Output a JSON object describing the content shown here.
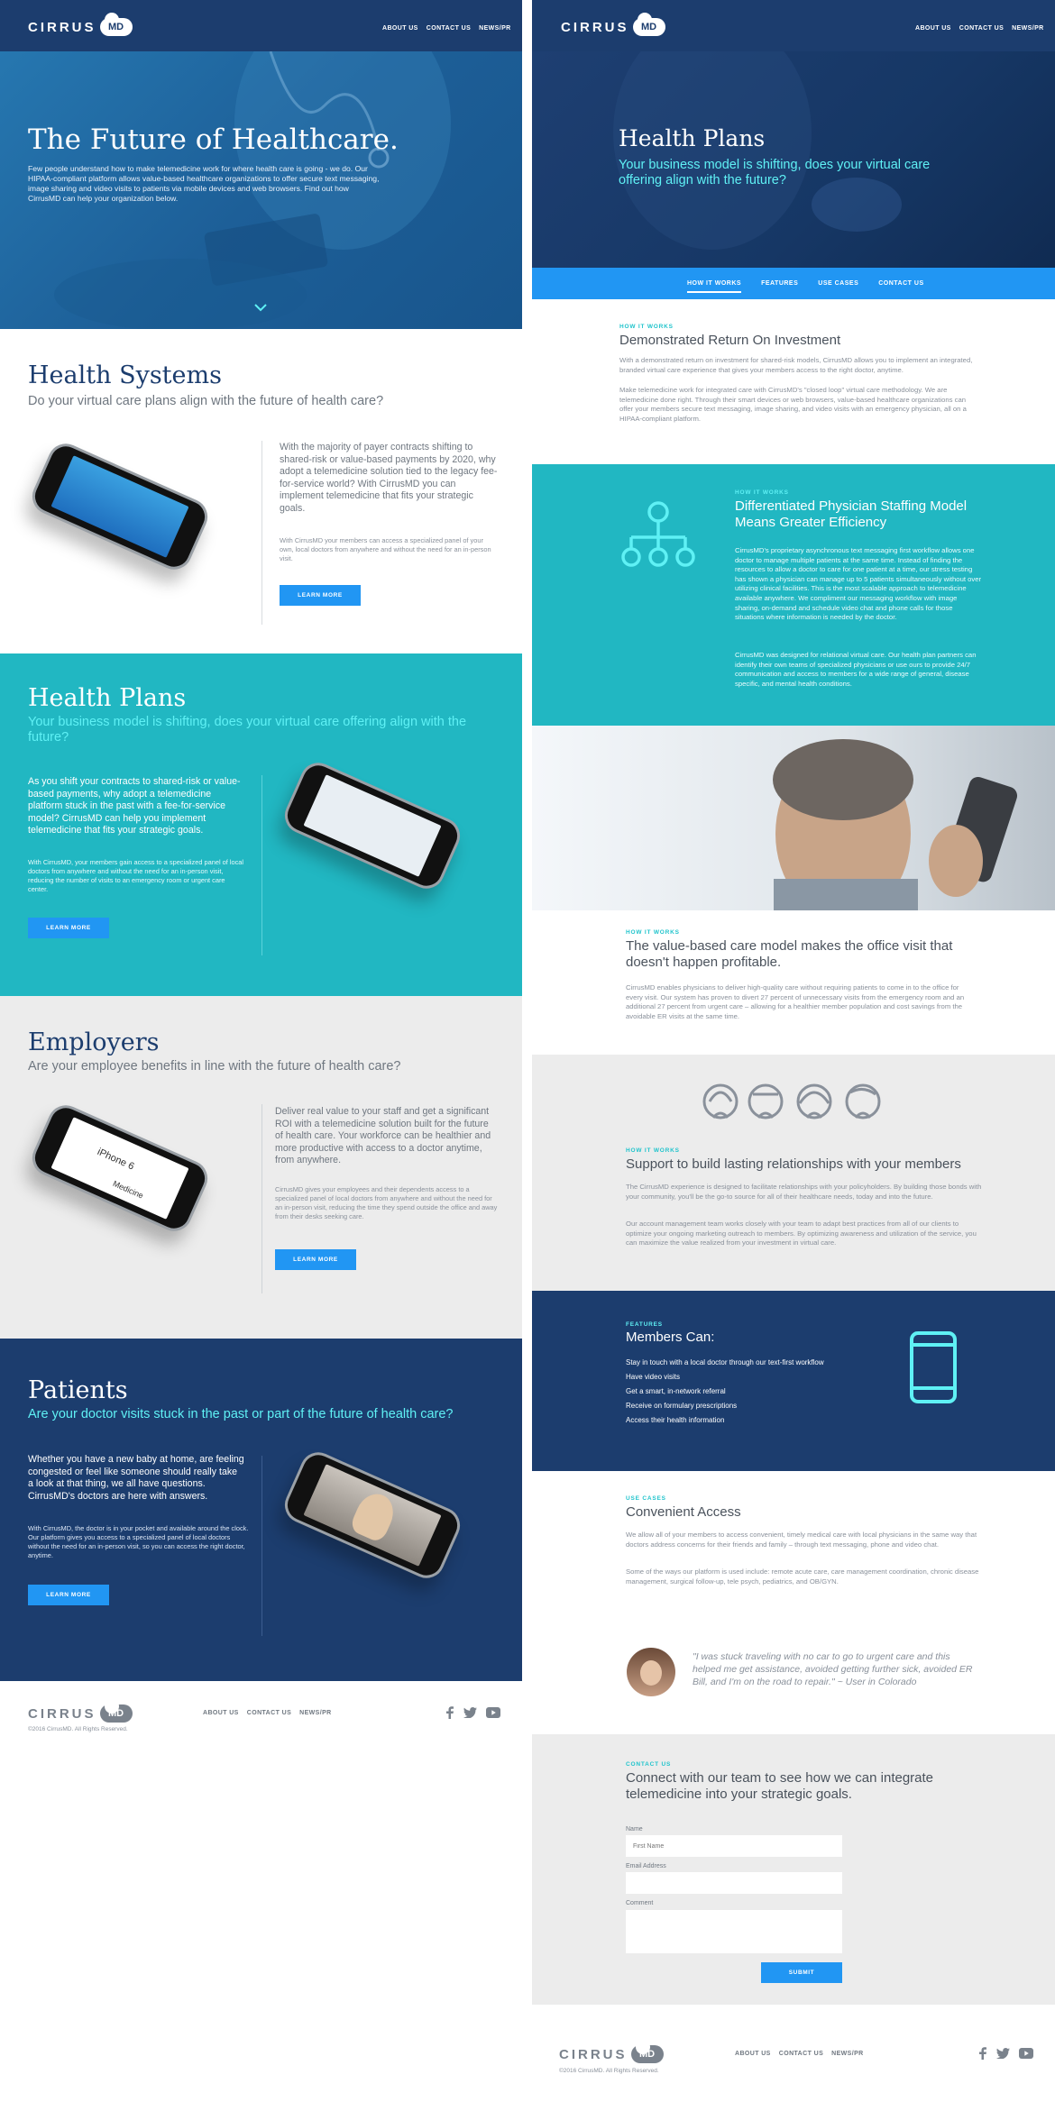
{
  "brand": {
    "logo_text": "CIRRUS",
    "logo_badge": "MD"
  },
  "nav": {
    "links": [
      "ABOUT US",
      "CONTACT US",
      "NEWS/PR"
    ]
  },
  "home": {
    "hero": {
      "title": "The Future of Healthcare.",
      "body": "Few people understand how to make telemedicine work for where health care is going - we do. Our HIPAA-compliant platform allows value-based healthcare organizations to offer secure text messaging, image sharing and video visits to patients via mobile devices and web browsers. Find out how CirrusMD can help your organization below."
    },
    "health_systems": {
      "title": "Health Systems",
      "subtitle": "Do your virtual care plans align with the future of health care?",
      "lead": "With the majority of payer contracts shifting to shared-risk or value-based payments by 2020, why adopt a telemedicine solution tied to the legacy fee-for-service world? With CirrusMD you can implement telemedicine that fits your strategic goals.",
      "body": "With CirrusMD your members can access a specialized panel of your own, local doctors from anywhere and without the need for an in-person visit.",
      "button": "LEARN MORE"
    },
    "health_plans": {
      "title": "Health Plans",
      "subtitle": "Your business model is shifting, does your virtual care offering align with the future?",
      "lead": "As you shift your contracts to shared-risk or value-based payments, why adopt a telemedicine platform stuck in the past with a fee-for-service model? CirrusMD can help you implement telemedicine that fits your strategic goals.",
      "body": "With CirrusMD, your members gain access to a specialized panel of local doctors from anywhere and without the need for an in-person visit, reducing the number of visits to an emergency room or urgent care center.",
      "button": "LEARN MORE"
    },
    "employers": {
      "title": "Employers",
      "subtitle": "Are your employee benefits in line with the future of health care?",
      "lead": "Deliver real value to your staff and get a significant ROI with a telemedicine solution built for the future of health care. Your workforce can be healthier and more productive with access to a doctor anytime, from anywhere.",
      "body": "CirrusMD gives your employees and their dependents access to a specialized panel of local doctors from anywhere and without the need for an in-person visit, reducing the time they spend outside the office and away from their desks seeking care.",
      "button": "LEARN MORE",
      "phone_text_1": "iPhone 6",
      "phone_text_2": "Medicine"
    },
    "patients": {
      "title": "Patients",
      "subtitle": "Are your doctor visits stuck in the past or part of the future of health care?",
      "lead": "Whether you have a new baby at home, are feeling congested or feel like someone should really take a look at that thing, we all have questions. CirrusMD's doctors are here with answers.",
      "body": "With CirrusMD, the doctor is in your pocket and available around the clock. Our platform gives you access to a specialized panel of local doctors without the need for an in-person visit, so you can access the right doctor, anytime.",
      "button": "LEARN MORE"
    },
    "footer": {
      "links": [
        "ABOUT US",
        "CONTACT US",
        "NEWS/PR"
      ],
      "copyright": "©2016 CirrusMD. All Rights Reserved."
    }
  },
  "plans": {
    "hero": {
      "title": "Health Plans",
      "subtitle": "Your business model is shifting, does your virtual care offering align with the future?"
    },
    "tabs": [
      "HOW IT WORKS",
      "FEATURES",
      "USE CASES",
      "CONTACT US"
    ],
    "roi": {
      "kicker": "HOW IT WORKS",
      "title": "Demonstrated Return On Investment",
      "p1": "With a demonstrated return on investment for shared-risk models, CirrusMD allows you to implement an integrated, branded virtual care experience that gives your members access to the right doctor, anytime.",
      "p2": "Make telemedicine work for integrated care with CirrusMD's \"closed loop\" virtual care methodology. We are telemedicine done right. Through their smart devices or web browsers, value-based healthcare organizations can offer your members secure text messaging, image sharing, and video visits with an emergency physician, all on a HIPAA-compliant platform."
    },
    "staffing": {
      "kicker": "HOW IT WORKS",
      "title": "Differentiated Physician Staffing Model Means Greater Efficiency",
      "p1": "CirrusMD's proprietary asynchronous text messaging first workflow allows one doctor to manage multiple patients at the same time. Instead of finding the resources to allow a doctor to care for one patient at a time, our stress testing has shown a physician can manage up to 5 patients simultaneously without over utilizing clinical facilities. This is the most scalable approach to telemedicine available anywhere. We compliment our messaging workflow with image sharing, on-demand and schedule video chat and phone calls for those situations where information is needed by the doctor.",
      "p2": "CirrusMD was designed for relational virtual care. Our health plan partners can identify their own teams of specialized physicians or use ours to provide 24/7 communication and access to members for a wide range of general, disease specific, and mental health conditions."
    },
    "value": {
      "kicker": "HOW IT WORKS",
      "title": "The value-based care model makes the office visit that doesn't happen profitable.",
      "p1": "CirrusMD enables physicians to deliver high-quality care without requiring patients to come in to the office for every visit. Our system has proven to divert 27 percent of unnecessary visits from the emergency room and an additional 27 percent from urgent care – allowing for a healthier member population and cost savings from the avoidable ER visits at the same time."
    },
    "relationships": {
      "kicker": "HOW IT WORKS",
      "title": "Support to build lasting relationships with your members",
      "p1": "The CirrusMD experience is designed to facilitate relationships with your policyholders. By building those bonds with your community, you'll be the go-to source for all of their healthcare needs, today and into the future.",
      "p2": "Our account management team works closely with your team to adapt best practices from all of our clients to optimize your ongoing marketing outreach to members. By optimizing awareness and utilization of the service, you can maximize the value realized from your investment in virtual care."
    },
    "features": {
      "kicker": "FEATURES",
      "title": "Members Can:",
      "items": [
        "Stay in touch with a local doctor through our text-first workflow",
        "Have video visits",
        "Get a smart, in-network referral",
        "Receive on formulary prescriptions",
        "Access their health information"
      ]
    },
    "use_cases": {
      "kicker": "USE CASES",
      "title": "Convenient Access",
      "p1": "We allow all of your members to access convenient, timely medical care with local physicians in the same way that doctors address concerns for their friends and family – through text messaging, phone and video chat.",
      "p2": "Some of the ways our platform is used include: remote acute care, care management coordination, chronic disease management, surgical follow-up, tele psych, pediatrics, and OB/GYN.",
      "quote": "\"I was stuck traveling with no car to go to urgent care and this helped me get assistance, avoided getting further sick, avoided ER Bill, and I'm on the road to repair.\" ~ User in Colorado"
    },
    "contact": {
      "kicker": "CONTACT US",
      "title": "Connect with our team to see how we can integrate telemedicine into your strategic goals.",
      "name_label": "Name",
      "name_placeholder": "First Name",
      "email_label": "Email Address",
      "comment_label": "Comment",
      "submit": "SUBMIT"
    },
    "footer": {
      "links": [
        "ABOUT US",
        "CONTACT US",
        "NEWS/PR"
      ],
      "copyright": "©2016 CirrusMD. All Rights Reserved."
    }
  },
  "colors": {
    "navy": "#1c3d6e",
    "teal": "#21b7c2",
    "blue": "#2196f3",
    "gray": "#ececec",
    "cyan": "#5ff1f5"
  }
}
